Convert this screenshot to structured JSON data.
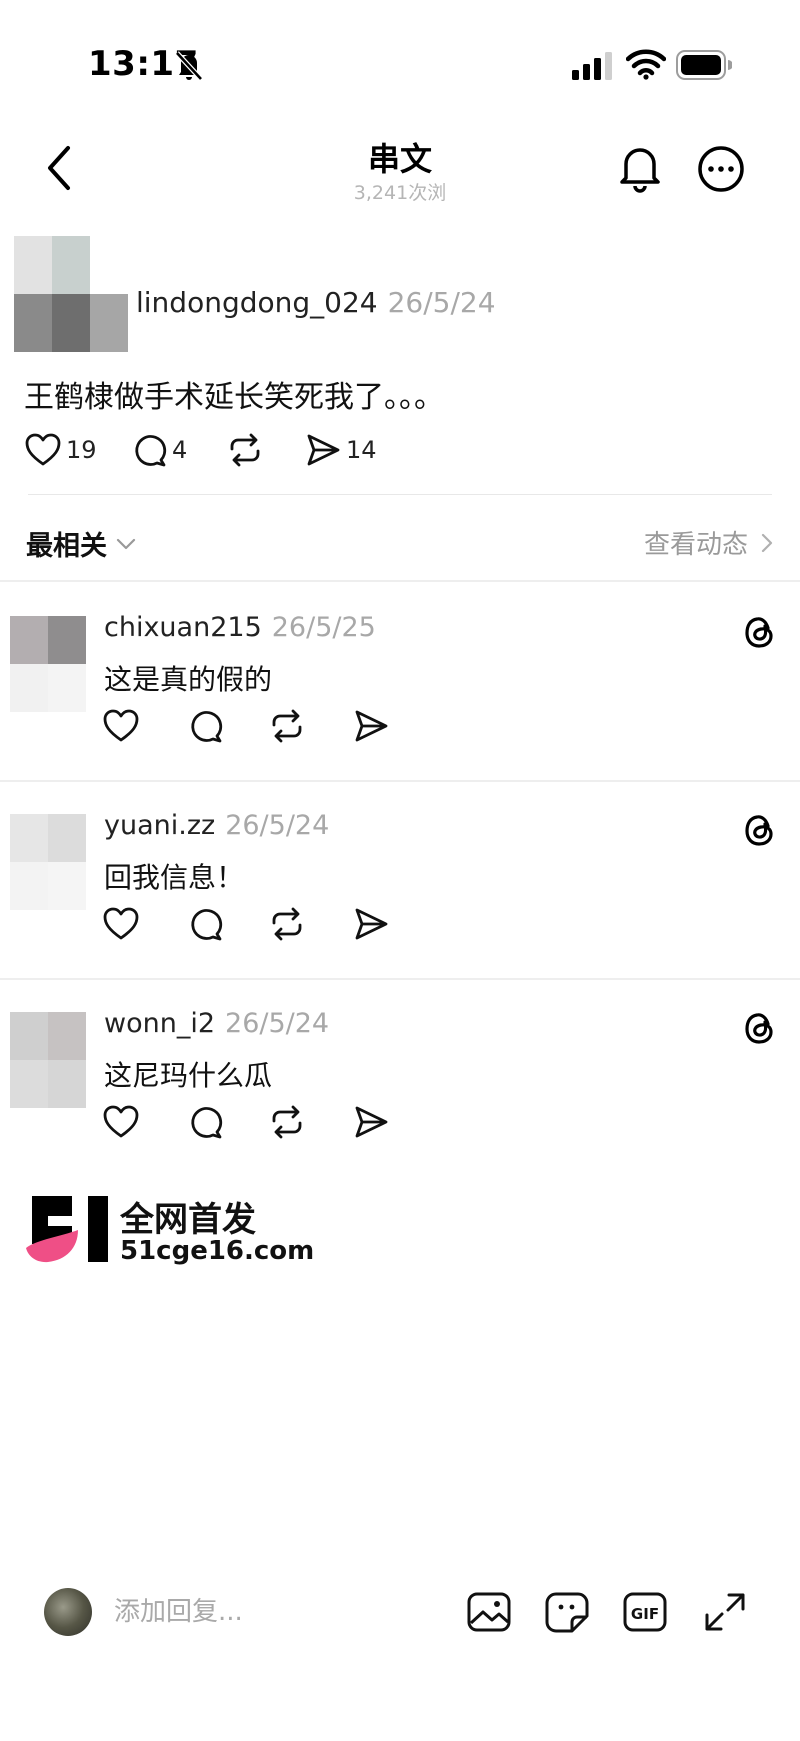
{
  "status_bar": {
    "time": "13:17"
  },
  "header": {
    "title": "串文",
    "view_count": "3,241次浏"
  },
  "post": {
    "username": "lindongdong_024",
    "time": "26/5/24",
    "text": "王鹤棣做手术延长笑死我了。。。",
    "likes": "19",
    "comments": "4",
    "shares": "14"
  },
  "sort": {
    "label": "最相关",
    "activity_label": "查看动态"
  },
  "replies": [
    {
      "username": "chixuan215",
      "time": "26/5/25",
      "text": "这是真的假的",
      "avatar_colors": [
        "#b3aeb0",
        "#8f8d8e",
        "#f1f1f1",
        "#f4f4f4"
      ]
    },
    {
      "username": "yuani.zz",
      "time": "26/5/24",
      "text": "回我信息！",
      "avatar_colors": [
        "#e6e6e6",
        "#dcdcdc",
        "#f3f3f3",
        "#f5f5f5"
      ]
    },
    {
      "username": "wonn_i2",
      "time": "26/5/24",
      "text": "这尼玛什么瓜",
      "avatar_colors": [
        "#cfcfcf",
        "#c6c2c2",
        "#dcdcdc",
        "#d6d6d6"
      ]
    }
  ],
  "op_avatar_colors": [
    "#e2e2e2",
    "#c8d0ce",
    "#ffffff",
    "#8a8a8a",
    "#6e6e6e",
    "#a6a6a6"
  ],
  "watermark": {
    "line1": "全网首发",
    "line2": "51cge16.com",
    "brand_pink": "#ef4f86"
  },
  "composer": {
    "placeholder": "添加回复..."
  },
  "icons": [
    "bell-off",
    "signal",
    "wifi",
    "battery",
    "back-chevron",
    "notify-bell",
    "more-circle",
    "heart",
    "comment",
    "repost",
    "send",
    "threads",
    "image",
    "sticker",
    "gif",
    "expand"
  ]
}
